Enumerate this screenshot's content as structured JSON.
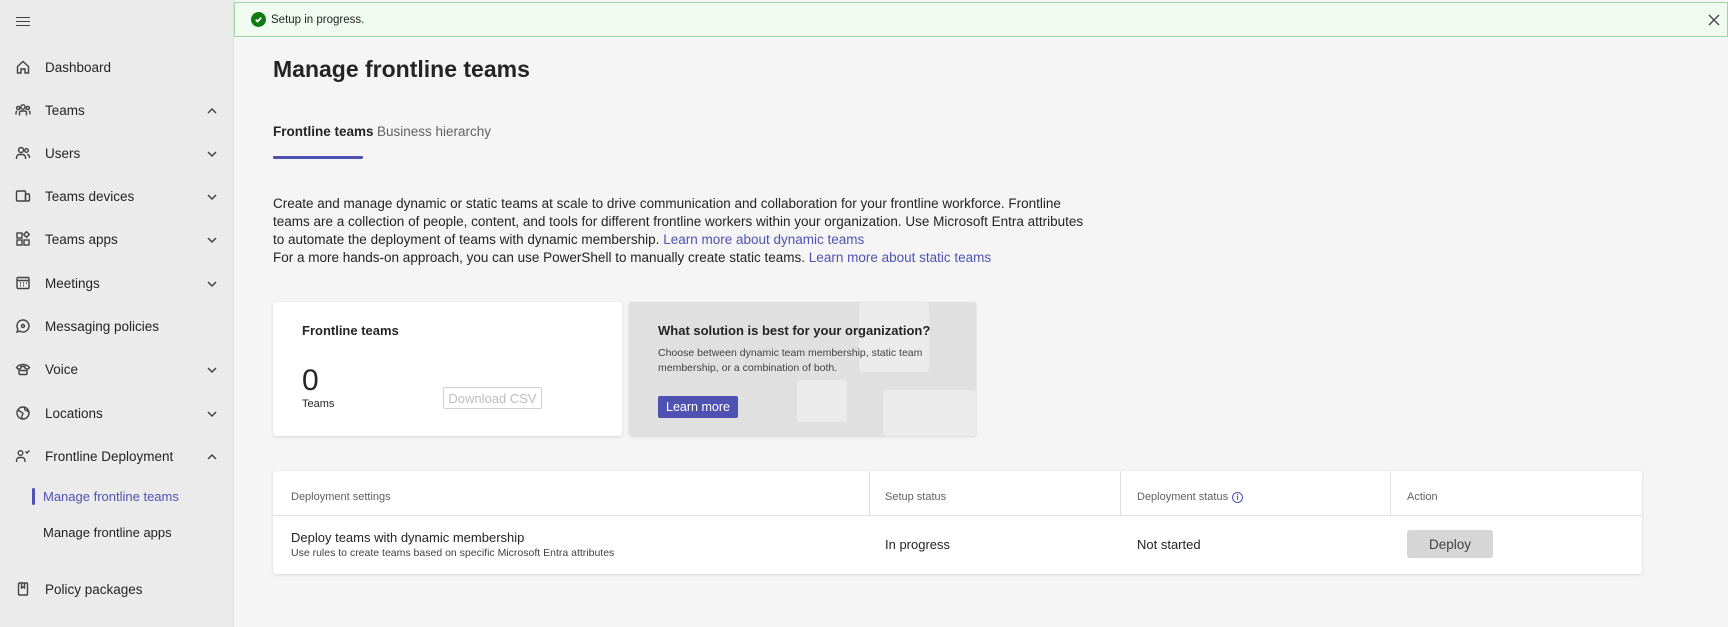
{
  "banner": {
    "text": "Setup in progress."
  },
  "sidebar": {
    "items": [
      {
        "label": "Dashboard"
      },
      {
        "label": "Teams"
      },
      {
        "label": "Users"
      },
      {
        "label": "Teams devices"
      },
      {
        "label": "Teams apps"
      },
      {
        "label": "Meetings"
      },
      {
        "label": "Messaging policies"
      },
      {
        "label": "Voice"
      },
      {
        "label": "Locations"
      },
      {
        "label": "Frontline Deployment"
      },
      {
        "label": "Policy packages"
      }
    ],
    "subitems": [
      {
        "label": "Manage frontline teams"
      },
      {
        "label": "Manage frontline apps"
      }
    ]
  },
  "page": {
    "title": "Manage frontline teams",
    "tabs": [
      {
        "label": "Frontline teams"
      },
      {
        "label": "Business hierarchy"
      }
    ],
    "desc1": "Create and manage dynamic or static teams at scale to drive communication and collaboration for your frontline workforce. Frontline teams are a collection of people, content, and tools for different frontline workers within your organization. Use Microsoft Entra attributes to automate the deployment of teams with dynamic membership.",
    "desc1_link": "Learn more about dynamic teams",
    "desc2": "For a more hands-on approach, you can use PowerShell to manually create static teams.",
    "desc2_link": "Learn more about static teams"
  },
  "teams_card": {
    "title": "Frontline teams",
    "count": "0",
    "count_label": "Teams",
    "download_label": "Download CSV"
  },
  "solution_card": {
    "title": "What solution is best for your organization?",
    "text": "Choose between dynamic team membership, static team membership, or a combination of both.",
    "button_label": "Learn more"
  },
  "table": {
    "headers": [
      "Deployment settings",
      "Setup status",
      "Deployment status",
      "Action"
    ],
    "rows": [
      {
        "title": "Deploy teams with dynamic membership",
        "subtitle": "Use rules to create teams based on specific Microsoft Entra attributes",
        "setup_status": "In progress",
        "deployment_status": "Not started",
        "action_label": "Deploy"
      }
    ]
  },
  "colors": {
    "accent": "#4f52b2",
    "success": "#107c10",
    "banner_bg": "#f1faf1"
  }
}
